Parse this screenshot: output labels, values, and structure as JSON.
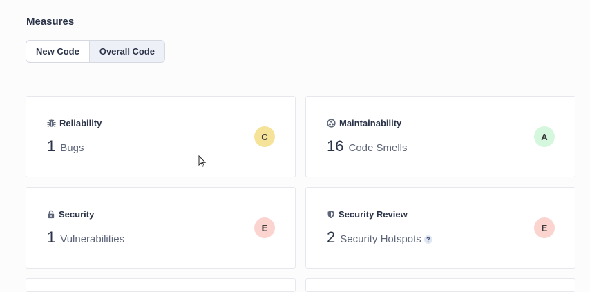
{
  "measures": {
    "title": "Measures",
    "tabs": [
      {
        "label": "New Code",
        "active": false
      },
      {
        "label": "Overall Code",
        "active": true
      }
    ]
  },
  "cards": [
    {
      "title": "Reliability",
      "icon": "bug-icon",
      "value": "1",
      "unit": "Bugs",
      "grade": "C",
      "grade_color": "#f5e39a"
    },
    {
      "title": "Maintainability",
      "icon": "maintainability-icon",
      "value": "16",
      "unit": "Code Smells",
      "grade": "A",
      "grade_color": "#d4f7dd"
    },
    {
      "title": "Security",
      "icon": "lock-icon",
      "value": "1",
      "unit": "Vulnerabilities",
      "grade": "E",
      "grade_color": "#fbd3cf"
    },
    {
      "title": "Security Review",
      "icon": "shield-icon",
      "value": "2",
      "unit": "Security Hotspots",
      "help": "?",
      "grade": "E",
      "grade_color": "#fbd3cf"
    }
  ]
}
